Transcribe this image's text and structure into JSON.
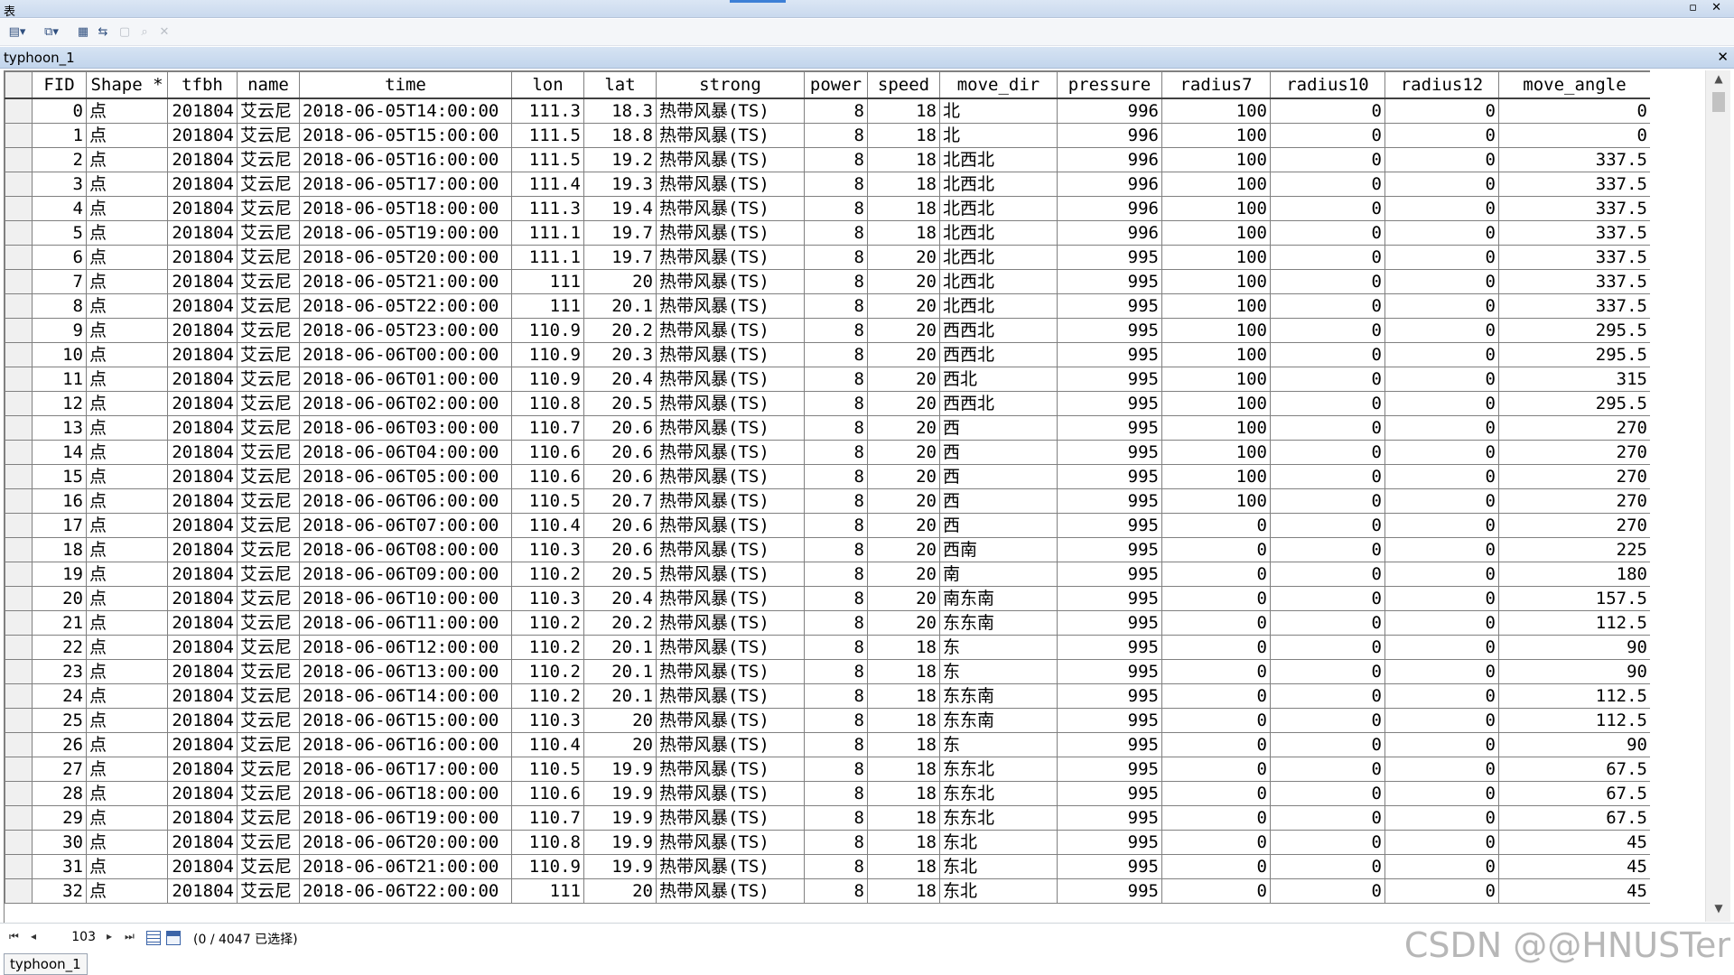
{
  "window": {
    "title": "表",
    "controls": "▫ ✕"
  },
  "toolbar": {
    "table_options_icon": "▤▾",
    "related_tables_icon": "⧉▾",
    "select_by_attr_icon": "▦",
    "switch_selection_icon": "⇆",
    "clear_selection_icon": "▢",
    "zoom_selected_icon": "⌕",
    "delete_icon": "✕"
  },
  "tab": {
    "name": "typhoon_1",
    "close": "✕"
  },
  "table": {
    "columns": [
      "FID",
      "Shape *",
      "tfbh",
      "name",
      "time",
      "lon",
      "lat",
      "strong",
      "power",
      "speed",
      "move_dir",
      "pressure",
      "radius7",
      "radius10",
      "radius12",
      "move_angle"
    ],
    "rows": [
      [
        "0",
        "点",
        "201804",
        "艾云尼",
        "2018-06-05T14:00:00",
        "111.3",
        "18.3",
        "热带风暴(TS)",
        "8",
        "18",
        "北",
        "996",
        "100",
        "0",
        "0",
        "0"
      ],
      [
        "1",
        "点",
        "201804",
        "艾云尼",
        "2018-06-05T15:00:00",
        "111.5",
        "18.8",
        "热带风暴(TS)",
        "8",
        "18",
        "北",
        "996",
        "100",
        "0",
        "0",
        "0"
      ],
      [
        "2",
        "点",
        "201804",
        "艾云尼",
        "2018-06-05T16:00:00",
        "111.5",
        "19.2",
        "热带风暴(TS)",
        "8",
        "18",
        "北西北",
        "996",
        "100",
        "0",
        "0",
        "337.5"
      ],
      [
        "3",
        "点",
        "201804",
        "艾云尼",
        "2018-06-05T17:00:00",
        "111.4",
        "19.3",
        "热带风暴(TS)",
        "8",
        "18",
        "北西北",
        "996",
        "100",
        "0",
        "0",
        "337.5"
      ],
      [
        "4",
        "点",
        "201804",
        "艾云尼",
        "2018-06-05T18:00:00",
        "111.3",
        "19.4",
        "热带风暴(TS)",
        "8",
        "18",
        "北西北",
        "996",
        "100",
        "0",
        "0",
        "337.5"
      ],
      [
        "5",
        "点",
        "201804",
        "艾云尼",
        "2018-06-05T19:00:00",
        "111.1",
        "19.7",
        "热带风暴(TS)",
        "8",
        "18",
        "北西北",
        "996",
        "100",
        "0",
        "0",
        "337.5"
      ],
      [
        "6",
        "点",
        "201804",
        "艾云尼",
        "2018-06-05T20:00:00",
        "111.1",
        "19.7",
        "热带风暴(TS)",
        "8",
        "20",
        "北西北",
        "995",
        "100",
        "0",
        "0",
        "337.5"
      ],
      [
        "7",
        "点",
        "201804",
        "艾云尼",
        "2018-06-05T21:00:00",
        "111",
        "20",
        "热带风暴(TS)",
        "8",
        "20",
        "北西北",
        "995",
        "100",
        "0",
        "0",
        "337.5"
      ],
      [
        "8",
        "点",
        "201804",
        "艾云尼",
        "2018-06-05T22:00:00",
        "111",
        "20.1",
        "热带风暴(TS)",
        "8",
        "20",
        "北西北",
        "995",
        "100",
        "0",
        "0",
        "337.5"
      ],
      [
        "9",
        "点",
        "201804",
        "艾云尼",
        "2018-06-05T23:00:00",
        "110.9",
        "20.2",
        "热带风暴(TS)",
        "8",
        "20",
        "西西北",
        "995",
        "100",
        "0",
        "0",
        "295.5"
      ],
      [
        "10",
        "点",
        "201804",
        "艾云尼",
        "2018-06-06T00:00:00",
        "110.9",
        "20.3",
        "热带风暴(TS)",
        "8",
        "20",
        "西西北",
        "995",
        "100",
        "0",
        "0",
        "295.5"
      ],
      [
        "11",
        "点",
        "201804",
        "艾云尼",
        "2018-06-06T01:00:00",
        "110.9",
        "20.4",
        "热带风暴(TS)",
        "8",
        "20",
        "西北",
        "995",
        "100",
        "0",
        "0",
        "315"
      ],
      [
        "12",
        "点",
        "201804",
        "艾云尼",
        "2018-06-06T02:00:00",
        "110.8",
        "20.5",
        "热带风暴(TS)",
        "8",
        "20",
        "西西北",
        "995",
        "100",
        "0",
        "0",
        "295.5"
      ],
      [
        "13",
        "点",
        "201804",
        "艾云尼",
        "2018-06-06T03:00:00",
        "110.7",
        "20.6",
        "热带风暴(TS)",
        "8",
        "20",
        "西",
        "995",
        "100",
        "0",
        "0",
        "270"
      ],
      [
        "14",
        "点",
        "201804",
        "艾云尼",
        "2018-06-06T04:00:00",
        "110.6",
        "20.6",
        "热带风暴(TS)",
        "8",
        "20",
        "西",
        "995",
        "100",
        "0",
        "0",
        "270"
      ],
      [
        "15",
        "点",
        "201804",
        "艾云尼",
        "2018-06-06T05:00:00",
        "110.6",
        "20.6",
        "热带风暴(TS)",
        "8",
        "20",
        "西",
        "995",
        "100",
        "0",
        "0",
        "270"
      ],
      [
        "16",
        "点",
        "201804",
        "艾云尼",
        "2018-06-06T06:00:00",
        "110.5",
        "20.7",
        "热带风暴(TS)",
        "8",
        "20",
        "西",
        "995",
        "100",
        "0",
        "0",
        "270"
      ],
      [
        "17",
        "点",
        "201804",
        "艾云尼",
        "2018-06-06T07:00:00",
        "110.4",
        "20.6",
        "热带风暴(TS)",
        "8",
        "20",
        "西",
        "995",
        "0",
        "0",
        "0",
        "270"
      ],
      [
        "18",
        "点",
        "201804",
        "艾云尼",
        "2018-06-06T08:00:00",
        "110.3",
        "20.6",
        "热带风暴(TS)",
        "8",
        "20",
        "西南",
        "995",
        "0",
        "0",
        "0",
        "225"
      ],
      [
        "19",
        "点",
        "201804",
        "艾云尼",
        "2018-06-06T09:00:00",
        "110.2",
        "20.5",
        "热带风暴(TS)",
        "8",
        "20",
        "南",
        "995",
        "0",
        "0",
        "0",
        "180"
      ],
      [
        "20",
        "点",
        "201804",
        "艾云尼",
        "2018-06-06T10:00:00",
        "110.3",
        "20.4",
        "热带风暴(TS)",
        "8",
        "20",
        "南东南",
        "995",
        "0",
        "0",
        "0",
        "157.5"
      ],
      [
        "21",
        "点",
        "201804",
        "艾云尼",
        "2018-06-06T11:00:00",
        "110.2",
        "20.2",
        "热带风暴(TS)",
        "8",
        "20",
        "东东南",
        "995",
        "0",
        "0",
        "0",
        "112.5"
      ],
      [
        "22",
        "点",
        "201804",
        "艾云尼",
        "2018-06-06T12:00:00",
        "110.2",
        "20.1",
        "热带风暴(TS)",
        "8",
        "18",
        "东",
        "995",
        "0",
        "0",
        "0",
        "90"
      ],
      [
        "23",
        "点",
        "201804",
        "艾云尼",
        "2018-06-06T13:00:00",
        "110.2",
        "20.1",
        "热带风暴(TS)",
        "8",
        "18",
        "东",
        "995",
        "0",
        "0",
        "0",
        "90"
      ],
      [
        "24",
        "点",
        "201804",
        "艾云尼",
        "2018-06-06T14:00:00",
        "110.2",
        "20.1",
        "热带风暴(TS)",
        "8",
        "18",
        "东东南",
        "995",
        "0",
        "0",
        "0",
        "112.5"
      ],
      [
        "25",
        "点",
        "201804",
        "艾云尼",
        "2018-06-06T15:00:00",
        "110.3",
        "20",
        "热带风暴(TS)",
        "8",
        "18",
        "东东南",
        "995",
        "0",
        "0",
        "0",
        "112.5"
      ],
      [
        "26",
        "点",
        "201804",
        "艾云尼",
        "2018-06-06T16:00:00",
        "110.4",
        "20",
        "热带风暴(TS)",
        "8",
        "18",
        "东",
        "995",
        "0",
        "0",
        "0",
        "90"
      ],
      [
        "27",
        "点",
        "201804",
        "艾云尼",
        "2018-06-06T17:00:00",
        "110.5",
        "19.9",
        "热带风暴(TS)",
        "8",
        "18",
        "东东北",
        "995",
        "0",
        "0",
        "0",
        "67.5"
      ],
      [
        "28",
        "点",
        "201804",
        "艾云尼",
        "2018-06-06T18:00:00",
        "110.6",
        "19.9",
        "热带风暴(TS)",
        "8",
        "18",
        "东东北",
        "995",
        "0",
        "0",
        "0",
        "67.5"
      ],
      [
        "29",
        "点",
        "201804",
        "艾云尼",
        "2018-06-06T19:00:00",
        "110.7",
        "19.9",
        "热带风暴(TS)",
        "8",
        "18",
        "东东北",
        "995",
        "0",
        "0",
        "0",
        "67.5"
      ],
      [
        "30",
        "点",
        "201804",
        "艾云尼",
        "2018-06-06T20:00:00",
        "110.8",
        "19.9",
        "热带风暴(TS)",
        "8",
        "18",
        "东北",
        "995",
        "0",
        "0",
        "0",
        "45"
      ],
      [
        "31",
        "点",
        "201804",
        "艾云尼",
        "2018-06-06T21:00:00",
        "110.9",
        "19.9",
        "热带风暴(TS)",
        "8",
        "18",
        "东北",
        "995",
        "0",
        "0",
        "0",
        "45"
      ],
      [
        "32",
        "点",
        "201804",
        "艾云尼",
        "2018-06-06T22:00:00",
        "111",
        "20",
        "热带风暴(TS)",
        "8",
        "18",
        "东北",
        "995",
        "0",
        "0",
        "0",
        "45"
      ]
    ]
  },
  "navigation": {
    "first": "⏮",
    "prev": "◂",
    "next": "▸",
    "last": "⏭",
    "current_record": "103",
    "status": "(0 / 4047 已选择)"
  },
  "bottom_tab": {
    "name": "typhoon_1"
  },
  "watermark": "CSDN @@HNUSTer"
}
